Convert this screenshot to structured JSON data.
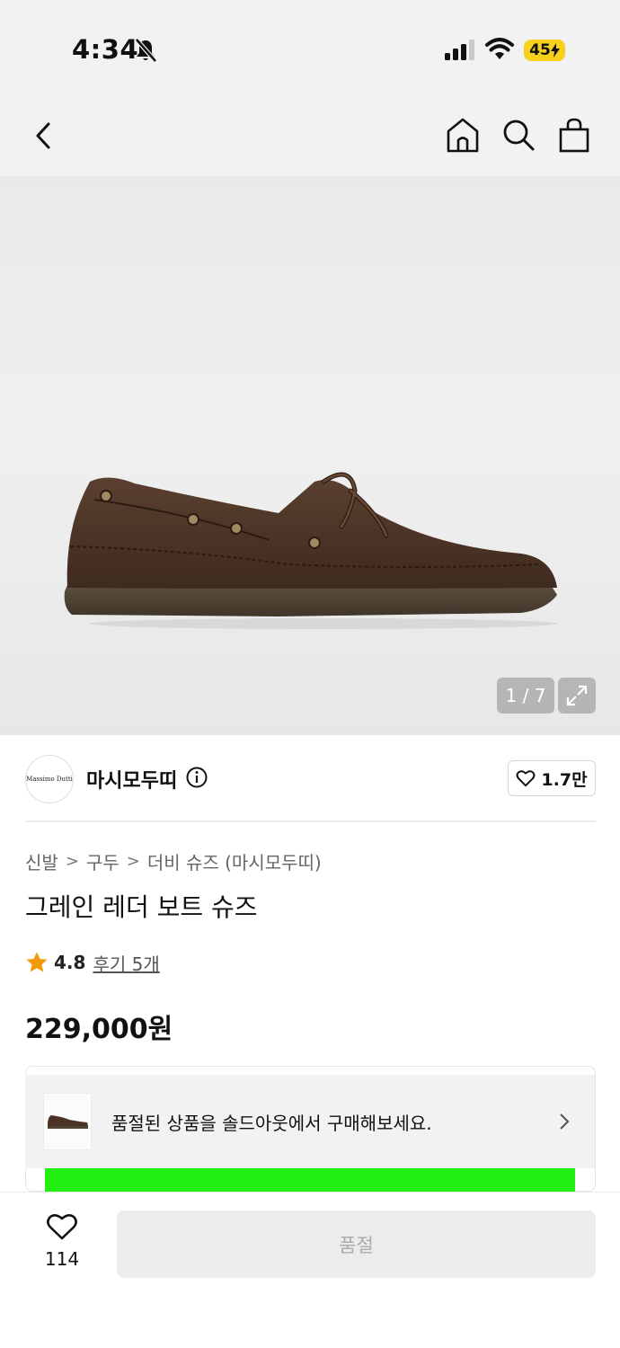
{
  "status_bar": {
    "time": "4:34",
    "battery": "45"
  },
  "nav": {
    "back_icon": "chevron-left-icon",
    "home_icon": "home-icon",
    "search_icon": "search-icon",
    "bag_icon": "shopping-bag-icon"
  },
  "gallery": {
    "counter": "1 / 7",
    "expand_icon": "expand-icon"
  },
  "brand": {
    "logo_text": "Massimo Dutti",
    "name": "마시모두띠",
    "likes": "1.7만"
  },
  "breadcrumb": {
    "items": [
      "신발",
      "구두",
      "더비 슈즈 (마시모두띠)"
    ],
    "separator": ">"
  },
  "product": {
    "title": "그레인 레더 보트 슈즈",
    "rating": "4.8",
    "review_label": "후기 5개",
    "price": "229,000원"
  },
  "soldout_notice": {
    "text": "품절된 상품을 솔드아웃에서 구매해보세요."
  },
  "bottom_bar": {
    "wish_count": "114",
    "buy_label": "품절"
  },
  "colors": {
    "accent_star": "#f39a0b",
    "banner_green": "#22ee11",
    "battery_yellow": "#f7d21c"
  }
}
